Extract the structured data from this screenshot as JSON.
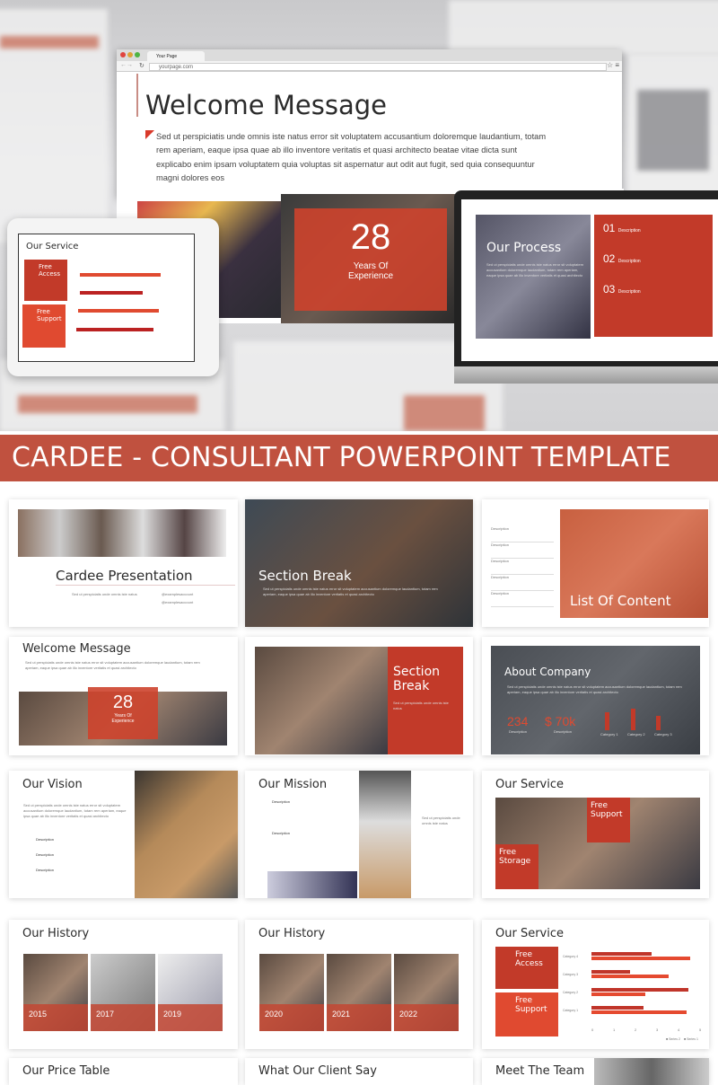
{
  "colors": {
    "accent": "#c23a29",
    "banner": "#c0513f"
  },
  "browser": {
    "tab_title": "Your Page",
    "url": "yourpage.com",
    "icons": [
      "back-icon",
      "forward-icon",
      "reload-icon",
      "star-icon",
      "menu-icon"
    ]
  },
  "hero": {
    "title": "Welcome Message",
    "body": "Sed ut perspiciatis unde omnis iste natus error sit voluptatem accusantium doloremque laudantium, totam rem aperiam, eaque ipsa quae ab illo inventore veritatis et quasi architecto beatae vitae dicta sunt explicabo enim ipsam voluptatem quia voluptas sit aspernatur aut odit aut fugit, sed quia consequuntur magni dolores eos",
    "experience": {
      "number": "28",
      "label": "Years Of Experience"
    },
    "tablet": {
      "title": "Our Service",
      "card1": "Free Access",
      "card2": "Free Support"
    },
    "laptop": {
      "title": "Our Process",
      "steps": [
        {
          "num": "01",
          "label": "Description"
        },
        {
          "num": "02",
          "label": "Description"
        },
        {
          "num": "03",
          "label": "Description"
        }
      ]
    }
  },
  "banner": "CARDEE - CONSULTANT POWERPOINT TEMPLATE",
  "lorem": "Sed ut perspiciatis unde omnis iste natus error sit voluptatem accusantium doloremque laudantium, totam rem aperiam, eaque ipsa quae ab illo inventore veritatis et quasi architecto",
  "lorem_short": "Sed ut perspiciatis unde omnis iste natus",
  "slides": {
    "cardee": {
      "title": "Cardee Presentation",
      "contact1": "@examplesaccount",
      "contact2": "@examplesaccount"
    },
    "section1": {
      "title": "Section Break"
    },
    "contents": {
      "title": "List Of Content",
      "items": [
        "Description",
        "Description",
        "Description",
        "Description",
        "Description"
      ]
    },
    "welcome": {
      "title": "Welcome Message",
      "number": "28",
      "label": "Years Of Experience"
    },
    "section2": {
      "title": "Section Break"
    },
    "about": {
      "title": "About Company",
      "stat1": "234",
      "stat1_label": "Description",
      "stat2": "$ 70k",
      "stat2_label": "Description",
      "categories": [
        "Category 1",
        "Category 2",
        "Category 3"
      ]
    },
    "vision": {
      "title": "Our Vision",
      "items": [
        "Description",
        "Description",
        "Description"
      ]
    },
    "mission": {
      "title": "Our Mission",
      "items": [
        "Description",
        "Description"
      ]
    },
    "service1": {
      "title": "Our Service",
      "card1": "Free Support",
      "card2": "Free Storage"
    },
    "history1": {
      "title": "Our History",
      "years": [
        "2015",
        "2017",
        "2019"
      ]
    },
    "history2": {
      "title": "Our History",
      "years": [
        "2020",
        "2021",
        "2022"
      ]
    },
    "service2": {
      "title": "Our Service",
      "card1": "Free Access",
      "card2": "Free Support",
      "categories": [
        "Category 4",
        "Category 3",
        "Category 2",
        "Category 1"
      ],
      "axis": [
        "0",
        "1",
        "2",
        "3",
        "4",
        "5"
      ],
      "legend": [
        "Series 2",
        "Series 1"
      ]
    },
    "price": {
      "title": "Our Price Table"
    },
    "client": {
      "title": "What Our Client Say"
    },
    "team": {
      "title": "Meet The Team"
    }
  },
  "chart_data": {
    "type": "bar",
    "orientation": "horizontal",
    "categories": [
      "Category 4",
      "Category 3",
      "Category 2",
      "Category 1"
    ],
    "series": [
      {
        "name": "Series 1",
        "values": [
          2.8,
          1.8,
          4.5,
          2.4
        ]
      },
      {
        "name": "Series 2",
        "values": [
          4.6,
          3.6,
          2.5,
          4.4
        ]
      }
    ],
    "xlim": [
      0,
      5
    ]
  }
}
